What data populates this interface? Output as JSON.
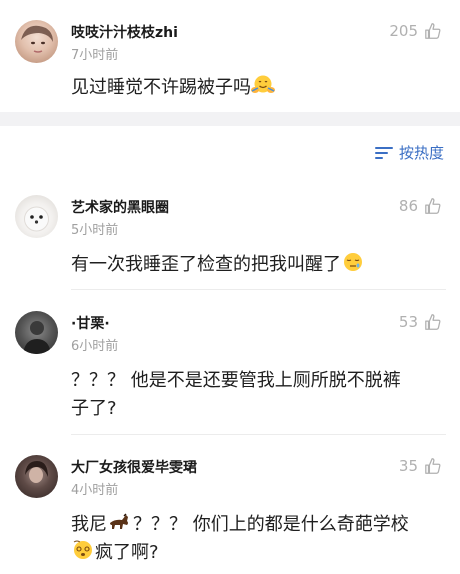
{
  "post": {
    "username": "吱吱汁汁枝枝zhi",
    "time": "7小时前",
    "likes": "205",
    "text": "见过睡觉不许踢被子吗",
    "emoji": "hugging-face-icon"
  },
  "sort": {
    "label": "按热度",
    "icon": "sort-lines-icon"
  },
  "comments": [
    {
      "username": "艺术家的黑眼圈",
      "time": "5小时前",
      "likes": "86",
      "text": "有一次我睡歪了检查的把我叫醒了",
      "emoji": "sleepy-face-icon"
    },
    {
      "username": "·甘栗·",
      "time": "6小时前",
      "likes": "53",
      "text_line1": "？？？ 他是不是还要管我上厕所脱不脱裤",
      "text_line2": "子了?"
    },
    {
      "username": "大厂女孩很爱毕雯珺",
      "time": "4小时前",
      "likes": "35",
      "text_part1": "我尼",
      "text_part2": "？？？ 你们上的都是什么奇葩学校",
      "text_part3": "疯了啊?",
      "emoji1": "horse-icon",
      "emoji2": "dizzy-face-icon"
    }
  ],
  "colors": {
    "accent": "#3b6fc4",
    "muted": "#a0a0a0",
    "gap": "#f2f2f4"
  }
}
